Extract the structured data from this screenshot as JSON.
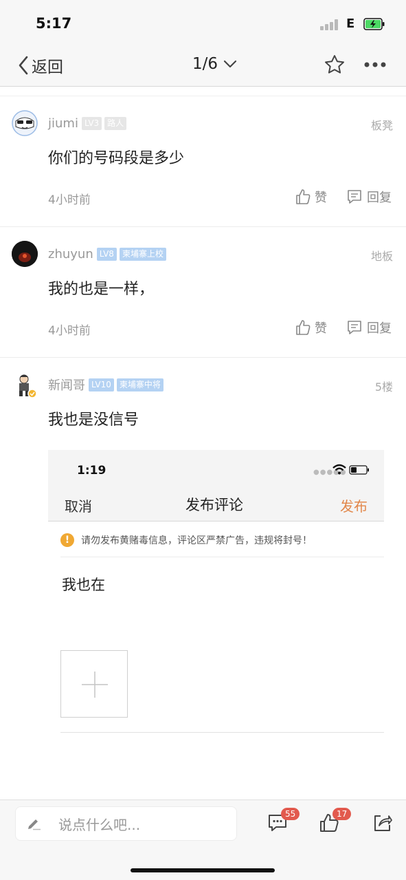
{
  "status_bar": {
    "time": "5:17",
    "network": "E"
  },
  "nav": {
    "back_label": "返回",
    "page_indicator": "1/6"
  },
  "comments": [
    {
      "user": "jiumi",
      "level": "LV3",
      "title": "路人",
      "floor": "板凳",
      "text": "你们的号码段是多少",
      "time": "4小时前",
      "like_label": "赞",
      "reply_label": "回复"
    },
    {
      "user": "zhuyun",
      "level": "LV8",
      "title": "柬埔寨上校",
      "floor": "地板",
      "text": "我的也是一样，",
      "time": "4小时前",
      "like_label": "赞",
      "reply_label": "回复"
    },
    {
      "user": "新闻哥",
      "level": "LV10",
      "title": "柬埔寨中将",
      "floor": "5楼",
      "text": "我也是没信号"
    }
  ],
  "embedded": {
    "time": "1:19",
    "cancel": "取消",
    "title": "发布评论",
    "publish": "发布",
    "warning": "请勿发布黄赌毒信息，评论区严禁广告，违规将封号！",
    "input_text": "我也在"
  },
  "bottom": {
    "placeholder": "说点什么吧...",
    "comment_count": "55",
    "like_count": "17"
  },
  "colors": {
    "accent": "#e2874a",
    "badge_red": "#e25a4e",
    "level_blue": "#b4d2f3"
  }
}
